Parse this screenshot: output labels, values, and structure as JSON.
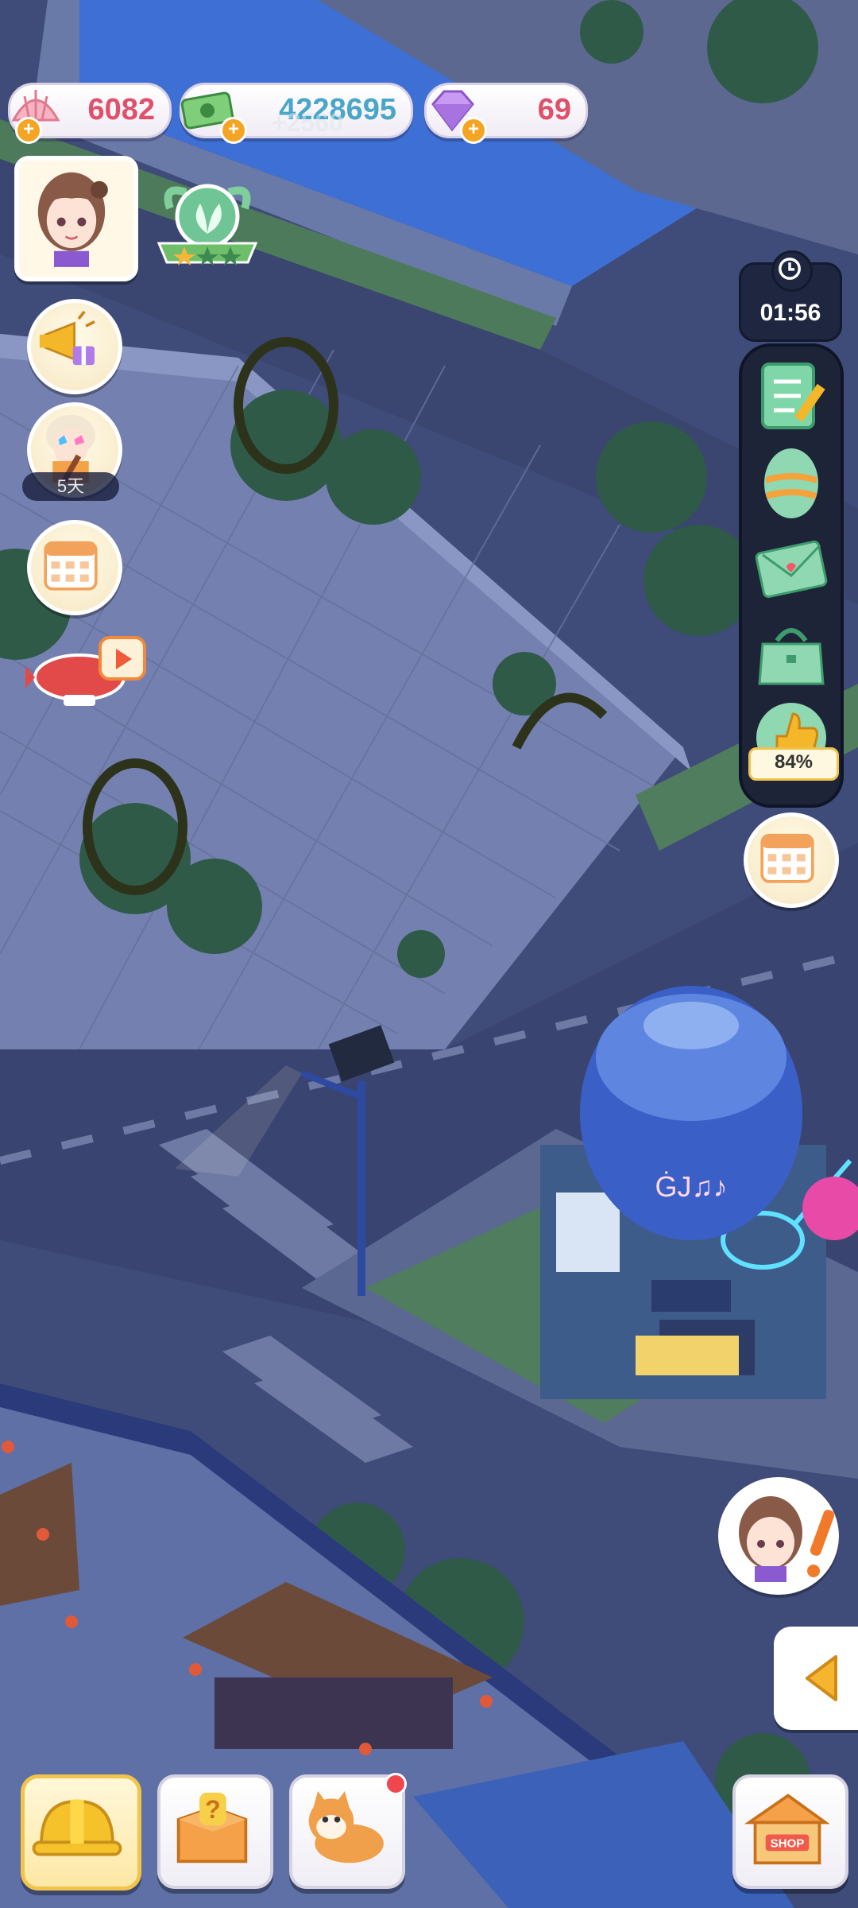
{
  "currencies": {
    "shells": {
      "value": "6082",
      "icon": "shell-icon",
      "color": "#e0506a"
    },
    "cash": {
      "value": "4228695",
      "icon": "cash-icon",
      "color": "#4aa6c8",
      "gain": "+2560"
    },
    "gems": {
      "value": "69",
      "icon": "gem-icon",
      "color": "#e0506a"
    }
  },
  "left_column": {
    "avatar": {
      "icon": "player-avatar"
    },
    "level_badge": {
      "icon": "leaf-badge-icon"
    },
    "announcement": {
      "icon": "megaphone-gift-icon"
    },
    "event_character": {
      "icon": "rockstar-event-icon",
      "days_label": "5天"
    },
    "calendar": {
      "icon": "calendar-icon"
    },
    "video_ad": {
      "icon": "airship-video-icon"
    }
  },
  "right_panel": {
    "timer": "01:56",
    "items": [
      {
        "icon": "task-list-icon"
      },
      {
        "icon": "easter-egg-icon"
      },
      {
        "icon": "mail-icon"
      },
      {
        "icon": "bag-icon"
      },
      {
        "icon": "thumbs-up-icon",
        "progress": "84%"
      }
    ],
    "calendar_button": {
      "icon": "calendar-icon"
    }
  },
  "bottom_bar": {
    "build": {
      "icon": "hard-hat-icon"
    },
    "mystery_box": {
      "icon": "mystery-box-icon"
    },
    "pet": {
      "icon": "shiba-dog-icon",
      "has_notification": true
    },
    "shop": {
      "icon": "shop-stall-icon",
      "sign": "SHOP"
    }
  },
  "npc_alert": {
    "icon": "girl-exclamation-icon"
  },
  "expand_arrow": {
    "icon": "left-arrow-icon"
  },
  "balloon_sign": "ĠJ♫♪ "
}
